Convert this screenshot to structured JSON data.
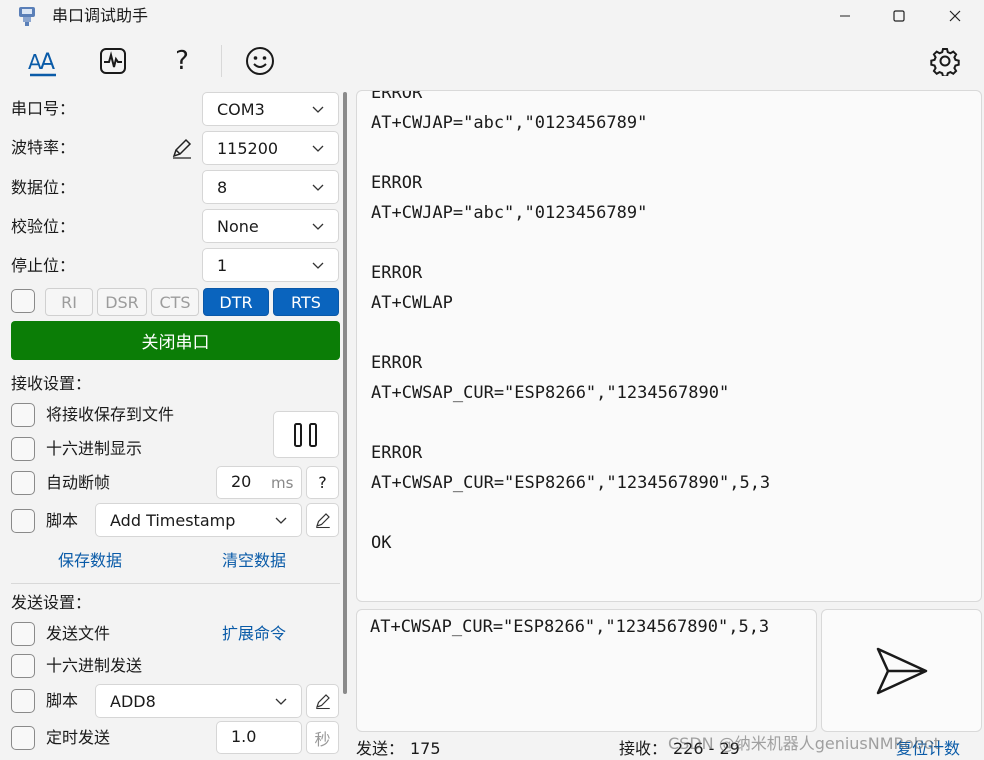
{
  "window": {
    "title": "串口调试助手",
    "minimize": "minimize",
    "maximize": "maximize",
    "close": "close"
  },
  "toolbar": {
    "icons": [
      "serial-font-icon",
      "waveform-icon",
      "help-icon",
      "smiley-icon",
      "settings-gear-icon"
    ],
    "help_glyph": "?"
  },
  "serial": {
    "port_label": "串口号：",
    "port_value": "COM3",
    "baud_label": "波特率：",
    "baud_value": "115200",
    "databits_label": "数据位：",
    "databits_value": "8",
    "parity_label": "校验位：",
    "parity_value": "None",
    "stopbits_label": "停止位：",
    "stopbits_value": "1",
    "signals": [
      {
        "label": "RI",
        "active": false
      },
      {
        "label": "DSR",
        "active": false
      },
      {
        "label": "CTS",
        "active": false
      },
      {
        "label": "DTR",
        "active": true
      },
      {
        "label": "RTS",
        "active": true
      }
    ],
    "close_port_label": "关闭串口",
    "accent": "#0b7d06",
    "signal_on_color": "#0a64be"
  },
  "receive": {
    "heading": "接收设置：",
    "save_to_file": "将接收保存到文件",
    "hex_display": "十六进制显示",
    "auto_frame": "自动断帧",
    "frame_ms_value": "20",
    "frame_ms_unit": "ms",
    "help_glyph": "?",
    "script_label": "脚本",
    "script_value": "Add Timestamp",
    "save_data": "保存数据",
    "clear_data": "清空数据"
  },
  "send": {
    "heading": "发送设置：",
    "send_file": "发送文件",
    "ext_commands": "扩展命令",
    "hex_send": "十六进制发送",
    "script_label": "脚本",
    "script_value": "ADD8",
    "timed_send": "定时发送",
    "interval_value": "1.0",
    "interval_unit": "秒",
    "input_text": "AT+CWSAP_CUR=\"ESP8266\",\"1234567890\",5,3"
  },
  "receive_log": [
    "ERROR",
    "AT+CWJAP=\"abc\",\"0123456789\"",
    "",
    "ERROR",
    "AT+CWJAP=\"abc\",\"0123456789\"",
    "",
    "ERROR",
    "AT+CWLAP",
    "",
    "ERROR",
    "AT+CWSAP_CUR=\"ESP8266\",\"1234567890\"",
    "",
    "ERROR",
    "AT+CWSAP_CUR=\"ESP8266\",\"1234567890\",5,3",
    "",
    "OK"
  ],
  "status": {
    "sent_label": "发送：",
    "sent_value": "175",
    "recv_label": "接收：",
    "recv_value": "226 - 29",
    "reset_label": "复位计数",
    "watermark": "CSDN @纳米机器人geniusNMRobot"
  }
}
